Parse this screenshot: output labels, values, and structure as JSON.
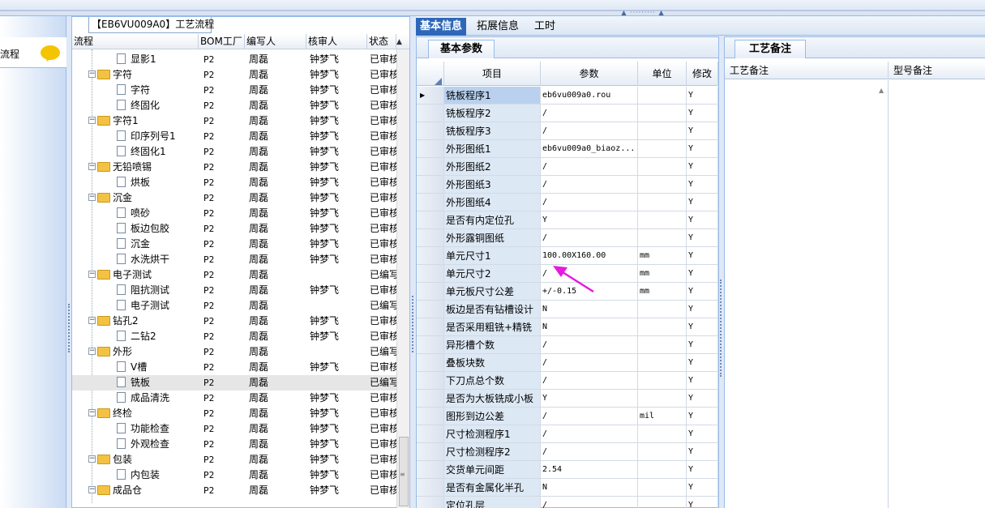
{
  "left_panel": {
    "item_label": "流程"
  },
  "tree_panel": {
    "title": "【EB6VU009A0】工艺流程",
    "columns": [
      "流程",
      "BOM工厂",
      "编写人",
      "核审人",
      "状态"
    ],
    "rows": [
      {
        "name": "显影1",
        "kind": "doc",
        "factory": "P2",
        "writer": "周磊",
        "reviewer": "钟梦飞",
        "status": "已审核"
      },
      {
        "name": "字符",
        "kind": "folder",
        "factory": "P2",
        "writer": "周磊",
        "reviewer": "钟梦飞",
        "status": "已审核"
      },
      {
        "name": "字符",
        "kind": "doc",
        "factory": "P2",
        "writer": "周磊",
        "reviewer": "钟梦飞",
        "status": "已审核"
      },
      {
        "name": "终固化",
        "kind": "doc",
        "factory": "P2",
        "writer": "周磊",
        "reviewer": "钟梦飞",
        "status": "已审核"
      },
      {
        "name": "字符1",
        "kind": "folder",
        "factory": "P2",
        "writer": "周磊",
        "reviewer": "钟梦飞",
        "status": "已审核"
      },
      {
        "name": "印序列号1",
        "kind": "doc",
        "factory": "P2",
        "writer": "周磊",
        "reviewer": "钟梦飞",
        "status": "已审核"
      },
      {
        "name": "终固化1",
        "kind": "doc",
        "factory": "P2",
        "writer": "周磊",
        "reviewer": "钟梦飞",
        "status": "已审核"
      },
      {
        "name": "无铅喷锡",
        "kind": "folder",
        "factory": "P2",
        "writer": "周磊",
        "reviewer": "钟梦飞",
        "status": "已审核"
      },
      {
        "name": "烘板",
        "kind": "doc",
        "factory": "P2",
        "writer": "周磊",
        "reviewer": "钟梦飞",
        "status": "已审核"
      },
      {
        "name": "沉金",
        "kind": "folder",
        "factory": "P2",
        "writer": "周磊",
        "reviewer": "钟梦飞",
        "status": "已审核"
      },
      {
        "name": "喷砂",
        "kind": "doc",
        "factory": "P2",
        "writer": "周磊",
        "reviewer": "钟梦飞",
        "status": "已审核"
      },
      {
        "name": "板边包胶",
        "kind": "doc",
        "factory": "P2",
        "writer": "周磊",
        "reviewer": "钟梦飞",
        "status": "已审核"
      },
      {
        "name": "沉金",
        "kind": "doc",
        "factory": "P2",
        "writer": "周磊",
        "reviewer": "钟梦飞",
        "status": "已审核"
      },
      {
        "name": "水洗烘干",
        "kind": "doc",
        "factory": "P2",
        "writer": "周磊",
        "reviewer": "钟梦飞",
        "status": "已审核"
      },
      {
        "name": "电子测试",
        "kind": "folder",
        "factory": "P2",
        "writer": "周磊",
        "reviewer": "",
        "status": "已编写"
      },
      {
        "name": "阻抗测试",
        "kind": "doc",
        "factory": "P2",
        "writer": "周磊",
        "reviewer": "钟梦飞",
        "status": "已审核"
      },
      {
        "name": "电子测试",
        "kind": "doc",
        "factory": "P2",
        "writer": "周磊",
        "reviewer": "",
        "status": "已编写"
      },
      {
        "name": "钻孔2",
        "kind": "folder",
        "factory": "P2",
        "writer": "周磊",
        "reviewer": "钟梦飞",
        "status": "已审核"
      },
      {
        "name": "二钻2",
        "kind": "doc",
        "factory": "P2",
        "writer": "周磊",
        "reviewer": "钟梦飞",
        "status": "已审核"
      },
      {
        "name": "外形",
        "kind": "folder",
        "factory": "P2",
        "writer": "周磊",
        "reviewer": "",
        "status": "已编写"
      },
      {
        "name": "V槽",
        "kind": "doc",
        "factory": "P2",
        "writer": "周磊",
        "reviewer": "钟梦飞",
        "status": "已审核"
      },
      {
        "name": "铣板",
        "kind": "doc",
        "factory": "P2",
        "writer": "周磊",
        "reviewer": "",
        "status": "已编写",
        "selected": true
      },
      {
        "name": "成品清洗",
        "kind": "doc",
        "factory": "P2",
        "writer": "周磊",
        "reviewer": "钟梦飞",
        "status": "已审核"
      },
      {
        "name": "终检",
        "kind": "folder",
        "factory": "P2",
        "writer": "周磊",
        "reviewer": "钟梦飞",
        "status": "已审核"
      },
      {
        "name": "功能检查",
        "kind": "doc",
        "factory": "P2",
        "writer": "周磊",
        "reviewer": "钟梦飞",
        "status": "已审核"
      },
      {
        "name": "外观检查",
        "kind": "doc",
        "factory": "P2",
        "writer": "周磊",
        "reviewer": "钟梦飞",
        "status": "已审核"
      },
      {
        "name": "包装",
        "kind": "folder",
        "factory": "P2",
        "writer": "周磊",
        "reviewer": "钟梦飞",
        "status": "已审核"
      },
      {
        "name": "内包装",
        "kind": "doc",
        "factory": "P2",
        "writer": "周磊",
        "reviewer": "钟梦飞",
        "status": "已审核"
      },
      {
        "name": "成品仓",
        "kind": "folder",
        "factory": "P2",
        "writer": "周磊",
        "reviewer": "钟梦飞",
        "status": "已审核"
      }
    ]
  },
  "main_tabs": [
    {
      "label": "基本信息",
      "active": true
    },
    {
      "label": "拓展信息",
      "active": false
    },
    {
      "label": "工时",
      "active": false
    }
  ],
  "params_panel": {
    "tab_label": "基本参数",
    "columns": [
      "项目",
      "参数",
      "单位",
      "修改"
    ],
    "rows": [
      {
        "item": "铣板程序1",
        "value": "eb6vu009a0.rou",
        "unit": "",
        "mod": "Y",
        "current": true
      },
      {
        "item": "铣板程序2",
        "value": "/",
        "unit": "",
        "mod": "Y"
      },
      {
        "item": "铣板程序3",
        "value": "/",
        "unit": "",
        "mod": "Y"
      },
      {
        "item": "外形图纸1",
        "value": "eb6vu009a0_biaoz...",
        "unit": "",
        "mod": "Y"
      },
      {
        "item": "外形图纸2",
        "value": "/",
        "unit": "",
        "mod": "Y"
      },
      {
        "item": "外形图纸3",
        "value": "/",
        "unit": "",
        "mod": "Y"
      },
      {
        "item": "外形图纸4",
        "value": "/",
        "unit": "",
        "mod": "Y"
      },
      {
        "item": "是否有内定位孔",
        "value": "Y",
        "unit": "",
        "mod": "Y"
      },
      {
        "item": "外形露铜图纸",
        "value": "/",
        "unit": "",
        "mod": "Y"
      },
      {
        "item": "单元尺寸1",
        "value": "100.00X160.00",
        "unit": "mm",
        "mod": "Y"
      },
      {
        "item": "单元尺寸2",
        "value": "/",
        "unit": "mm",
        "mod": "Y"
      },
      {
        "item": "单元板尺寸公差",
        "value": "+/-0.15",
        "unit": "mm",
        "mod": "Y"
      },
      {
        "item": "板边是否有钻槽设计",
        "value": "N",
        "unit": "",
        "mod": "Y"
      },
      {
        "item": "是否采用粗铣+精铣",
        "value": "N",
        "unit": "",
        "mod": "Y"
      },
      {
        "item": "异形槽个数",
        "value": "/",
        "unit": "",
        "mod": "Y"
      },
      {
        "item": "叠板块数",
        "value": "/",
        "unit": "",
        "mod": "Y"
      },
      {
        "item": "下刀点总个数",
        "value": "/",
        "unit": "",
        "mod": "Y"
      },
      {
        "item": "是否为大板铣成小板",
        "value": "Y",
        "unit": "",
        "mod": "Y"
      },
      {
        "item": "图形到边公差",
        "value": "/",
        "unit": "mil",
        "mod": "Y"
      },
      {
        "item": "尺寸检测程序1",
        "value": "/",
        "unit": "",
        "mod": "Y"
      },
      {
        "item": "尺寸检测程序2",
        "value": "/",
        "unit": "",
        "mod": "Y"
      },
      {
        "item": "交货单元间距",
        "value": "2.54",
        "unit": "",
        "mod": "Y"
      },
      {
        "item": "是否有金属化半孔",
        "value": "N",
        "unit": "",
        "mod": "Y"
      },
      {
        "item": "定位孔层",
        "value": "/",
        "unit": "",
        "mod": "Y"
      }
    ]
  },
  "notes_panel": {
    "tab_label": "工艺备注",
    "columns": [
      "工艺备注",
      "型号备注"
    ]
  },
  "colors": {
    "active_tab": "#2e67b8",
    "annotation_arrow": "#e619e0",
    "folder": "#f4c243"
  }
}
